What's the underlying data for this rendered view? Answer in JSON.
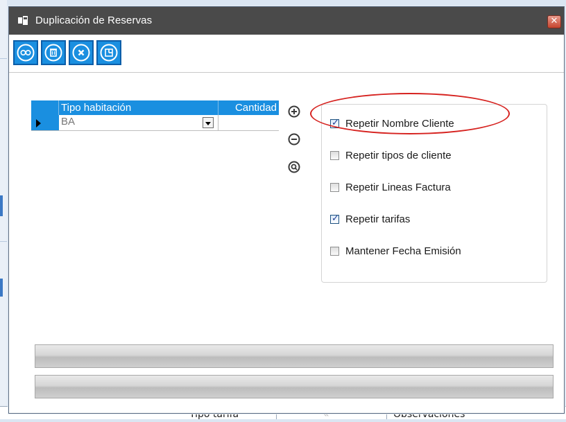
{
  "window": {
    "title": "Duplicación de Reservas",
    "close_label": "✕"
  },
  "toolbar": {
    "buttons": [
      {
        "icon": "duplicate-icon"
      },
      {
        "icon": "trash-icon"
      },
      {
        "icon": "cancel-icon"
      },
      {
        "icon": "exit-icon"
      }
    ]
  },
  "grid": {
    "columns": [
      "Tipo habitación",
      "Cantidad"
    ],
    "rows": [
      {
        "tipo": "BA",
        "cantidad": ""
      }
    ]
  },
  "row_actions": [
    "add-icon",
    "remove-icon",
    "search-icon"
  ],
  "options": [
    {
      "label": "Repetir Nombre Cliente",
      "checked": true
    },
    {
      "label": "Repetir tipos de cliente",
      "checked": false
    },
    {
      "label": "Repetir Lineas Factura",
      "checked": false
    },
    {
      "label": "Repetir tarifas",
      "checked": true
    },
    {
      "label": "Mantener Fecha Emisión",
      "checked": false
    }
  ],
  "background": {
    "bottom_labels": [
      "Tipo tarifa",
      "Observaciones"
    ]
  },
  "colors": {
    "titlebar": "#4a4a4a",
    "accent": "#1a8fe0",
    "highlight": "#d6221f"
  }
}
